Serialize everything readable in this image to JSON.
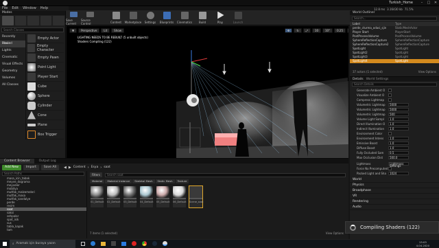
{
  "titlebar": {
    "project": "Turkish_Home",
    "fps": "77.9 FPS",
    "ms": "12.8 ms",
    "mem": "3.16430 kb",
    "mem2": "71.5%"
  },
  "menu": {
    "items": [
      "File",
      "Edit",
      "Window",
      "Help"
    ]
  },
  "modes": {
    "title": "Modes",
    "search_placeholder": "Search Classes",
    "categories": [
      "Recently Placed",
      "Basic",
      "Lights",
      "Cinematic",
      "Visual Effects",
      "Geometry",
      "Volumes",
      "All Classes"
    ],
    "items": [
      "Empty Actor",
      "Empty Character",
      "Empty Pawn",
      "Point Light",
      "Player Start",
      "Cube",
      "Sphere",
      "Cylinder",
      "Cone",
      "Plane",
      "Box Trigger"
    ]
  },
  "toolbar": {
    "buttons": [
      "Save Current",
      "Source Control",
      "Content",
      "Marketplace",
      "Settings",
      "Blueprints",
      "Cinematics",
      "Build",
      "Play",
      "Launch"
    ]
  },
  "viewport": {
    "mode": "Perspective",
    "view": "Lit",
    "show": "Show",
    "warning": "LIGHTING NEEDS TO BE REBUILT (5 unbuilt objects)",
    "shaders": "Shaders Compiling (122)",
    "grid": "10",
    "angle": "10°",
    "scale": "0.25",
    "speed": "4"
  },
  "content_browser": {
    "tabs": [
      "Content Browser",
      "Output Log"
    ],
    "add_new": "Add New",
    "import": "Import",
    "save_all": "Save All",
    "breadcrumb": [
      "Content",
      "Esya",
      "saat"
    ],
    "search_paths": "Search Paths",
    "filters": "Filters",
    "search_placeholder": "Search saat",
    "folders": [
      "masa_icin_tabak",
      "meyve_dograma",
      "meyveler",
      "mobilya",
      "mutfak_malzemeleri",
      "mutfak_masa",
      "mutfak_sandalye",
      "perde",
      "resim",
      "saat",
      "saksi",
      "sehpalar",
      "spot_isik",
      "sus",
      "tabla_kapak",
      "tam"
    ],
    "selected_folder": "saat",
    "type_headers": [
      "Material",
      "Material Instance",
      "Skeletal Mesh",
      "Static Mesh",
      "Texture"
    ],
    "assets": [
      {
        "label": "01_Default",
        "thumb": "#8a8a8a"
      },
      {
        "label": "02_Default",
        "thumb": "#bdbdbd"
      },
      {
        "label": "03_Default",
        "thumb": "#707070"
      },
      {
        "label": "04_Default",
        "thumb": "#a9c6cf"
      },
      {
        "label": "05_Default",
        "thumb": "#c9a8a8"
      },
      {
        "label": "06_Default",
        "thumb": "#d8d8d8"
      },
      {
        "label": "Scene_saat",
        "thumb": "#5a5a5a"
      }
    ],
    "status": "7 items (1 selected)",
    "view_options": "View Options"
  },
  "outliner": {
    "title": "World Outliner",
    "search_placeholder": "Search...",
    "columns": [
      "Label",
      "Type"
    ],
    "rows": [
      {
        "label": "perde_cturma_odasi_sjin",
        "type": "StaticMeshActor"
      },
      {
        "label": "Player Start",
        "type": "PlayerStart"
      },
      {
        "label": "PostProcessVolume",
        "type": "PostProcessVolume"
      },
      {
        "label": "SphereReflectionCapture",
        "type": "SphereReflectionCapture"
      },
      {
        "label": "SphereReflectionCapture2",
        "type": "SphereReflectionCapture"
      },
      {
        "label": "SpotLight",
        "type": "SpotLight"
      },
      {
        "label": "SpotLight2",
        "type": "SpotLight"
      },
      {
        "label": "SpotLight3",
        "type": "SpotLight"
      },
      {
        "label": "SpotLight4",
        "type": "SpotLight"
      }
    ],
    "selected_row": 8,
    "count": "37 actors (1 selected)",
    "view_options": "View Options"
  },
  "details": {
    "title": "Details",
    "tab2": "World Settings",
    "search_placeholder": "Search Details",
    "props": [
      {
        "name": "Generate Ambient O",
        "value": ""
      },
      {
        "name": "Visualize Ambient O",
        "value": ""
      },
      {
        "name": "Compress Lightmap",
        "value": ""
      },
      {
        "name": "Volumetric Lightmap",
        "value": "5000"
      },
      {
        "name": "Volumetric Lightmap",
        "value": "5000"
      },
      {
        "name": "Volumetric Lightmap",
        "value": "500"
      },
      {
        "name": "Volume Light Sampl",
        "value": "1.0"
      },
      {
        "name": "Direct Illumination O",
        "value": "1.0"
      },
      {
        "name": "Indirect Illumination",
        "value": "1.0"
      },
      {
        "name": "Environment Color",
        "value": ""
      },
      {
        "name": "Environment Intens",
        "value": "1.0"
      },
      {
        "name": "Emissive Boost",
        "value": "1.0"
      },
      {
        "name": "Diffuse Boost",
        "value": "1.0"
      },
      {
        "name": "Fully Occluded Sam",
        "value": "0.5"
      },
      {
        "name": "Max Occlusion Dist",
        "value": "500.0"
      }
    ],
    "lightmass": [
      {
        "name": "Lightmass",
        "value": "Lightmass Settings"
      },
      {
        "name": "Force No Precomputed",
        "value": ""
      },
      {
        "name": "Packed Light and Sha",
        "value": "1024"
      }
    ],
    "sections": [
      "World",
      "Physics",
      "Broadphase",
      "VR",
      "Rendering",
      "Audio"
    ]
  },
  "toast": {
    "text": "Compiling Shaders (122)"
  },
  "taskbar": {
    "search": "Aramak için buraya yazın",
    "time": "13:03",
    "date": "4.04.2020"
  }
}
